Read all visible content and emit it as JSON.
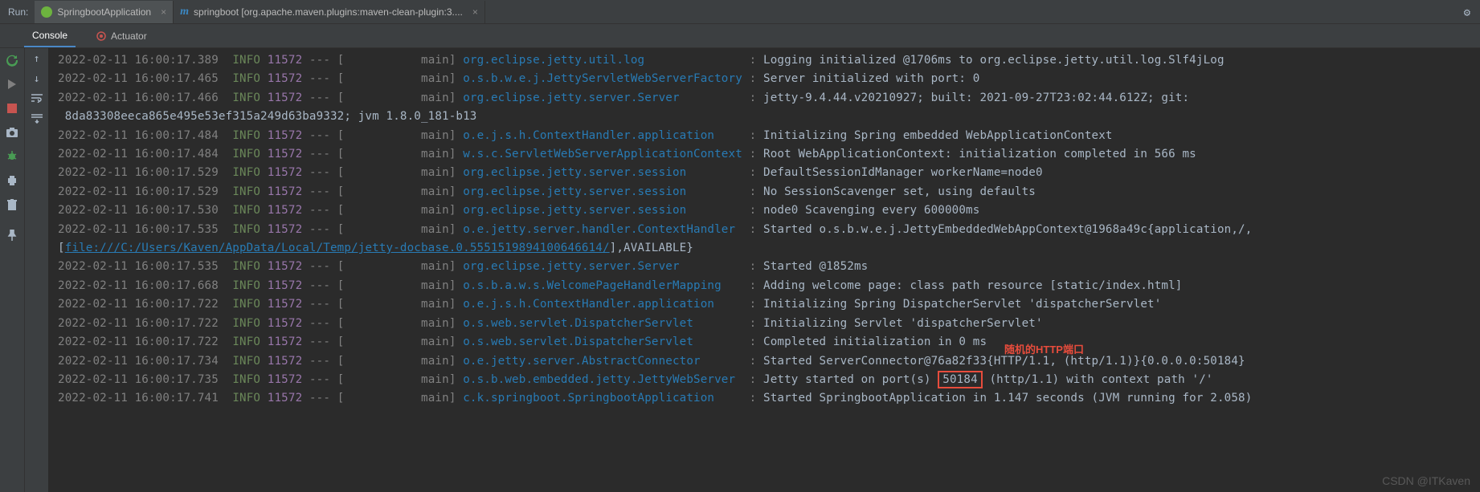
{
  "header": {
    "run_label": "Run:",
    "tabs": [
      {
        "label": "SpringbootApplication",
        "active": true,
        "icon": "spring"
      },
      {
        "label": "springboot [org.apache.maven.plugins:maven-clean-plugin:3....",
        "active": false,
        "icon": "maven"
      }
    ]
  },
  "sub_tabs": {
    "console": "Console",
    "actuator": "Actuator"
  },
  "log_level": "INFO",
  "pid": "11572",
  "separator": "---",
  "thread_prefix": "[",
  "thread_suffix": "main]",
  "colon": ":",
  "lines": [
    {
      "ts": "2022-02-11 16:00:17.389",
      "logger": "org.eclipse.jetty.util.log",
      "msg": "Logging initialized @1706ms to org.eclipse.jetty.util.log.Slf4jLog"
    },
    {
      "ts": "2022-02-11 16:00:17.465",
      "logger": "o.s.b.w.e.j.JettyServletWebServerFactory",
      "msg": "Server initialized with port: 0"
    },
    {
      "ts": "2022-02-11 16:00:17.466",
      "logger": "org.eclipse.jetty.server.Server",
      "msg": "jetty-9.4.44.v20210927; built: 2021-09-27T23:02:44.612Z; git:"
    },
    {
      "cont": " 8da83308eeca865e495e53ef315a249d63ba9332; jvm 1.8.0_181-b13"
    },
    {
      "ts": "2022-02-11 16:00:17.484",
      "logger": "o.e.j.s.h.ContextHandler.application",
      "msg": "Initializing Spring embedded WebApplicationContext"
    },
    {
      "ts": "2022-02-11 16:00:17.484",
      "logger": "w.s.c.ServletWebServerApplicationContext",
      "msg": "Root WebApplicationContext: initialization completed in 566 ms"
    },
    {
      "ts": "2022-02-11 16:00:17.529",
      "logger": "org.eclipse.jetty.server.session",
      "msg": "DefaultSessionIdManager workerName=node0"
    },
    {
      "ts": "2022-02-11 16:00:17.529",
      "logger": "org.eclipse.jetty.server.session",
      "msg": "No SessionScavenger set, using defaults"
    },
    {
      "ts": "2022-02-11 16:00:17.530",
      "logger": "org.eclipse.jetty.server.session",
      "msg": "node0 Scavenging every 600000ms"
    },
    {
      "ts": "2022-02-11 16:00:17.535",
      "logger": "o.e.jetty.server.handler.ContextHandler",
      "msg": "Started o.s.b.w.e.j.JettyEmbeddedWebAppContext@1968a49c{application,/,"
    },
    {
      "link_prefix": "[",
      "link": "file:///C:/Users/Kaven/AppData/Local/Temp/jetty-docbase.0.5551519894100646614/",
      "link_suffix": "],AVAILABLE}"
    },
    {
      "ts": "2022-02-11 16:00:17.535",
      "logger": "org.eclipse.jetty.server.Server",
      "msg": "Started @1852ms"
    },
    {
      "ts": "2022-02-11 16:00:17.668",
      "logger": "o.s.b.a.w.s.WelcomePageHandlerMapping",
      "msg": "Adding welcome page: class path resource [static/index.html]"
    },
    {
      "ts": "2022-02-11 16:00:17.722",
      "logger": "o.e.j.s.h.ContextHandler.application",
      "msg": "Initializing Spring DispatcherServlet 'dispatcherServlet'"
    },
    {
      "ts": "2022-02-11 16:00:17.722",
      "logger": "o.s.web.servlet.DispatcherServlet",
      "msg": "Initializing Servlet 'dispatcherServlet'"
    },
    {
      "ts": "2022-02-11 16:00:17.722",
      "logger": "o.s.web.servlet.DispatcherServlet",
      "msg": "Completed initialization in 0 ms"
    },
    {
      "ts": "2022-02-11 16:00:17.734",
      "logger": "o.e.jetty.server.AbstractConnector",
      "msg": "Started ServerConnector@76a82f33{HTTP/1.1, (http/1.1)}{0.0.0.0:50184}"
    },
    {
      "ts": "2022-02-11 16:00:17.735",
      "logger": "o.s.b.web.embedded.jetty.JettyWebServer",
      "msg_before": "Jetty started on port(s) ",
      "port": "50184",
      "msg_after": " (http/1.1) with context path '/'"
    },
    {
      "ts": "2022-02-11 16:00:17.741",
      "logger": "c.k.springboot.SpringbootApplication",
      "msg": "Started SpringbootApplication in 1.147 seconds (JVM running for 2.058)"
    }
  ],
  "annotation": "随机的HTTP端口",
  "watermark": "CSDN @ITKaven"
}
